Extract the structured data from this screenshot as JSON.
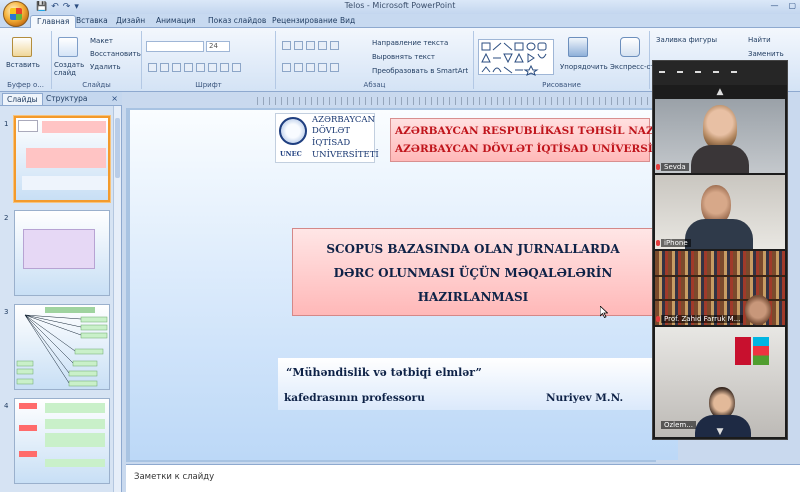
{
  "app": {
    "window_title": "Telos - Microsoft PowerPoint"
  },
  "ribbon": {
    "tabs": [
      "Главная",
      "Вставка",
      "Дизайн",
      "Анимация",
      "Показ слайдов",
      "Рецензирование",
      "Вид"
    ],
    "active_tab": "Главная",
    "clipboard": {
      "paste": "Вставить",
      "create_slide": "Создать слайд",
      "layout": "Макет",
      "restore": "Восстановить",
      "delete": "Удалить",
      "group_buffer": "Буфер о...",
      "group_slides": "Слайды"
    },
    "font": {
      "size": "24",
      "group": "Шрифт"
    },
    "paragraph": {
      "text_direction": "Направление текста",
      "align_text": "Выровнять текст",
      "smartart": "Преобразовать в SmartArt",
      "group": "Абзац"
    },
    "drawing": {
      "arrange": "Упорядочить",
      "quick_styles": "Экспресс-стили",
      "shape_fill": "Заливка фигуры",
      "group": "Рисование"
    },
    "editing": {
      "find": "Найти",
      "replace": "Заменить"
    }
  },
  "left_pane": {
    "tab_slides": "Слайды",
    "tab_structure": "Структура",
    "close": "×",
    "slide_numbers": [
      "1",
      "2",
      "3",
      "4"
    ]
  },
  "slide": {
    "logo": {
      "line1": "AZƏRBAYCAN",
      "line2": "DÖVLƏT",
      "line3": "İQTİSAD",
      "line4": "UNİVERSİTETİ",
      "abbr": "UNEC"
    },
    "ministry": {
      "line1": "AZƏRBAYCAN RESPUBLİKASI TƏHSİL NAZİRLİ",
      "line2": "AZƏRBAYCAN DÖVLƏT İQTİSAD UNİVERSİTET"
    },
    "title": {
      "line1": "SCOPUS BAZASINDA OLAN JURNALLARDA",
      "line2": "DƏRC OLUNMASI ÜÇÜN MƏQALƏLƏRİN",
      "line3": "HAZIRLANMASI"
    },
    "subtitle": {
      "dept": "“Mühəndislik və tətbiqi elmlər”",
      "position": "kafedrasının  professoru",
      "author": "Nuriyev M.N."
    }
  },
  "notes": {
    "placeholder": "Заметки к слайду"
  },
  "video_panel": {
    "participants": [
      {
        "name": "Sevda"
      },
      {
        "name": "iPhone"
      },
      {
        "name": "Prof. Zahid Farruk M..."
      },
      {
        "name": "Ozlem..."
      }
    ]
  }
}
